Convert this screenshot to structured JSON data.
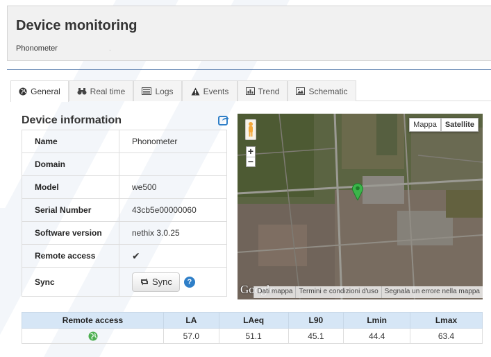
{
  "header": {
    "title": "Device monitoring",
    "subtitle": "Phonometer",
    "sub_dot": "."
  },
  "tabs": [
    {
      "label": "General",
      "icon": "globe-icon",
      "active": true
    },
    {
      "label": "Real time",
      "icon": "binoculars-icon",
      "active": false
    },
    {
      "label": "Logs",
      "icon": "list-icon",
      "active": false
    },
    {
      "label": "Events",
      "icon": "warning-icon",
      "active": false
    },
    {
      "label": "Trend",
      "icon": "bar-chart-icon",
      "active": false
    },
    {
      "label": "Schematic",
      "icon": "picture-icon",
      "active": false
    }
  ],
  "device_info": {
    "title": "Device information",
    "rows": [
      {
        "label": "Name",
        "value": "Phonometer"
      },
      {
        "label": "Domain",
        "value": ""
      },
      {
        "label": "Model",
        "value": "we500"
      },
      {
        "label": "Serial Number",
        "value": "43cb5e00000060"
      },
      {
        "label": "Software version",
        "value": "nethix 3.0.25"
      },
      {
        "label": "Remote access",
        "value": "✔"
      },
      {
        "label": "Sync",
        "value": ""
      }
    ],
    "sync_button": "Sync",
    "help": "?"
  },
  "map": {
    "type_map": "Mappa",
    "type_satellite": "Satellite",
    "zoom_in": "+",
    "zoom_out": "−",
    "logo": "Google",
    "footer": [
      "Dati mappa",
      "Termini e condizioni d'uso",
      "Segnala un errore nella mappa"
    ]
  },
  "measurements": {
    "headers": [
      "Remote access",
      "LA",
      "LAeq",
      "L90",
      "Lmin",
      "Lmax"
    ],
    "values": [
      "57.0",
      "51.1",
      "45.1",
      "44.4",
      "63.4"
    ]
  },
  "colors": {
    "accent": "#5c7faf",
    "table_header": "#d6e6f6",
    "ok": "#4caf50"
  }
}
